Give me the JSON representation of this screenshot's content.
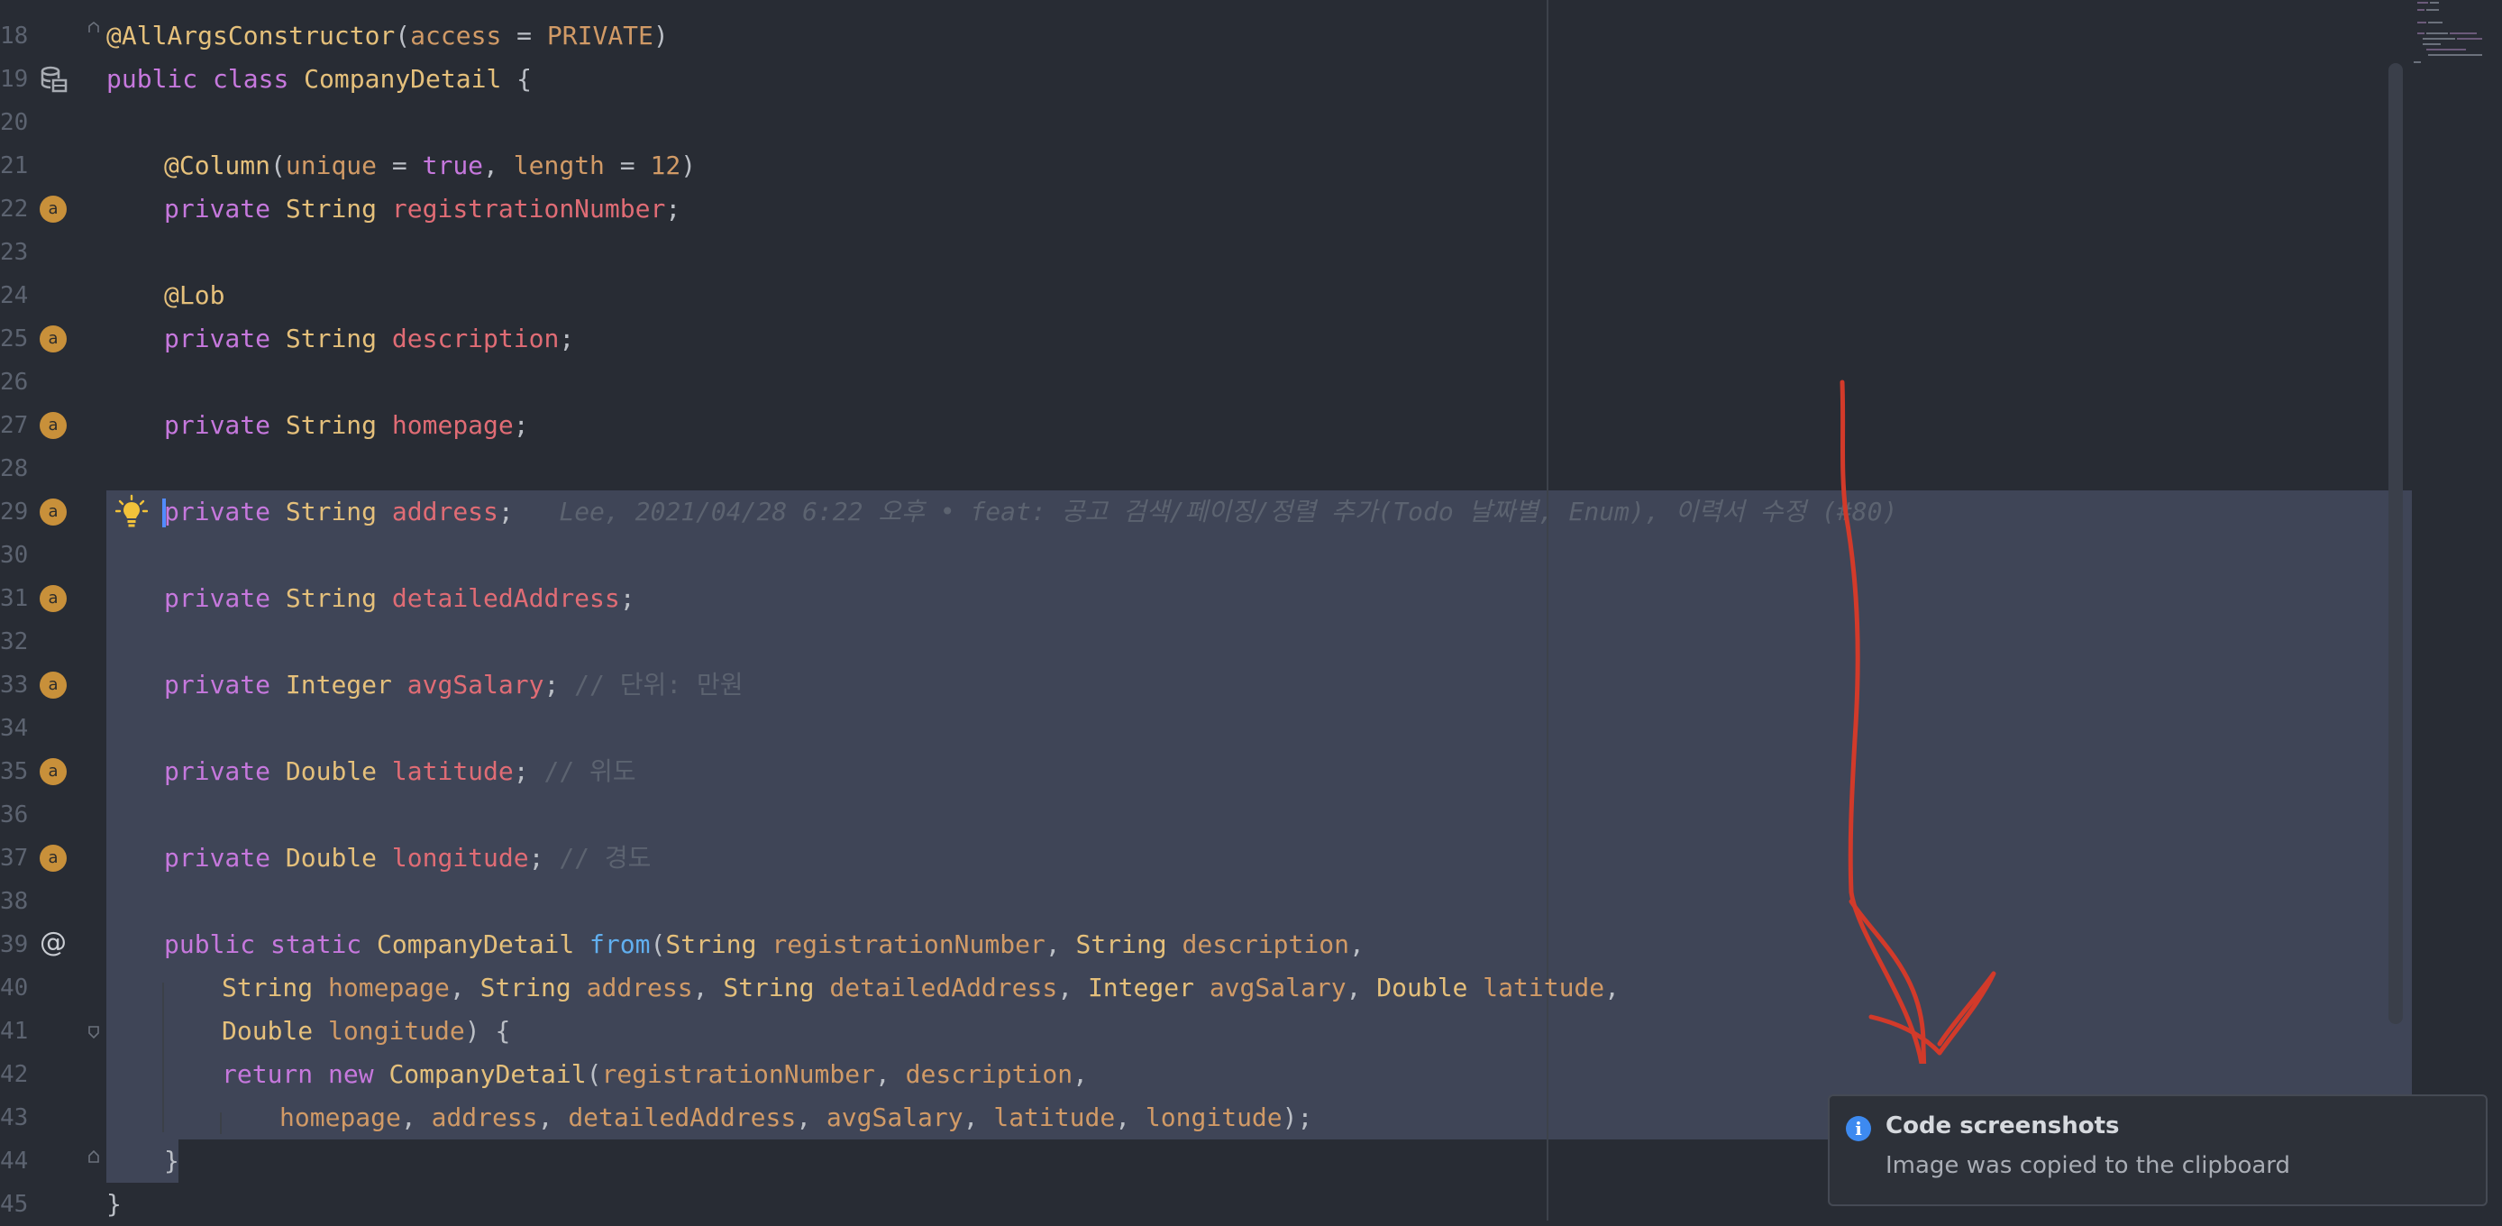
{
  "editor": {
    "line_numbers": [
      "18",
      "19",
      "20",
      "21",
      "22",
      "23",
      "24",
      "25",
      "26",
      "27",
      "28",
      "29",
      "30",
      "31",
      "32",
      "33",
      "34",
      "35",
      "36",
      "37",
      "38",
      "39",
      "40",
      "41",
      "42",
      "43",
      "44",
      "45"
    ],
    "code": {
      "l18": {
        "annotation": "@AllArgsConstructor",
        "open": "(",
        "param": "access",
        "eq": " = ",
        "value": "PRIVATE",
        "close": ")"
      },
      "l19": {
        "kw1": "public",
        "kw2": "class",
        "name": "CompanyDetail",
        "brace": " {"
      },
      "l21": {
        "annotation": "@Column",
        "open": "(",
        "p1": "unique",
        "eq1": " = ",
        "v1": "true",
        "sep": ", ",
        "p2": "length",
        "eq2": " = ",
        "v2": "12",
        "close": ")"
      },
      "l22": {
        "kw": "private",
        "type": "String",
        "field": "registrationNumber",
        "end": ";"
      },
      "l24": {
        "annotation": "@Lob"
      },
      "l25": {
        "kw": "private",
        "type": "String",
        "field": "description",
        "end": ";"
      },
      "l27": {
        "kw": "private",
        "type": "String",
        "field": "homepage",
        "end": ";"
      },
      "l29": {
        "kw": "private",
        "type": "String",
        "field": "address",
        "end": ";",
        "blame_author": "Lee, 2021/04/28 6:22 오후 • ",
        "blame_type": "feat:",
        "blame_msg": " 공고 검색/페이징/정렬 추가(Todo 날짜별, Enum), 이력서 수정 (#80)"
      },
      "l31": {
        "kw": "private",
        "type": "String",
        "field": "detailedAddress",
        "end": ";"
      },
      "l33": {
        "kw": "private",
        "type": "Integer",
        "field": "avgSalary",
        "end": ";",
        "comment": " // 단위: 만원"
      },
      "l35": {
        "kw": "private",
        "type": "Double",
        "field": "latitude",
        "end": ";",
        "comment": " // 위도"
      },
      "l37": {
        "kw": "private",
        "type": "Double",
        "field": "longitude",
        "end": ";",
        "comment": " // 경도"
      },
      "l39": {
        "kw1": "public",
        "kw2": "static",
        "type": "CompanyDetail",
        "method": "from",
        "open": "(",
        "t1": "String",
        "p1": "registrationNumber",
        "sep1": ", ",
        "t2": "String",
        "p2": "description",
        "end": ","
      },
      "l40": {
        "t1": "String",
        "p1": "homepage",
        "t2": "String",
        "p2": "address",
        "t3": "String",
        "p3": "detailedAddress",
        "t4": "Integer",
        "p4": "avgSalary",
        "t5": "Double",
        "p5": "latitude",
        "sep": ", ",
        "end": ","
      },
      "l41": {
        "t1": "Double",
        "p1": "longitude",
        "end": ") {"
      },
      "l42": {
        "kw1": "return",
        "kw2": "new",
        "type": "CompanyDetail",
        "open": "(",
        "a1": "registrationNumber",
        "sep": ", ",
        "a2": "description",
        "end": ","
      },
      "l43": {
        "a1": "homepage",
        "a2": "address",
        "a3": "detailedAddress",
        "a4": "avgSalary",
        "a5": "latitude",
        "a6": "longitude",
        "sep": ", ",
        "end": ");"
      },
      "l44": {
        "brace": "}"
      },
      "l45": {
        "brace": "}"
      }
    },
    "gutter_icons": {
      "field": "a",
      "override": "@"
    }
  },
  "notification": {
    "title": "Code screenshots",
    "body": "Image was copied to the clipboard",
    "icon": "info-icon"
  },
  "colors": {
    "background": "#282c34",
    "selection": "#3f4557",
    "keyword": "#c678dd",
    "type": "#e5c07b",
    "field": "#e06c75",
    "parameter": "#d19a66",
    "method": "#61afef",
    "comment": "#5c6370",
    "arrow": "#d23a2a"
  }
}
